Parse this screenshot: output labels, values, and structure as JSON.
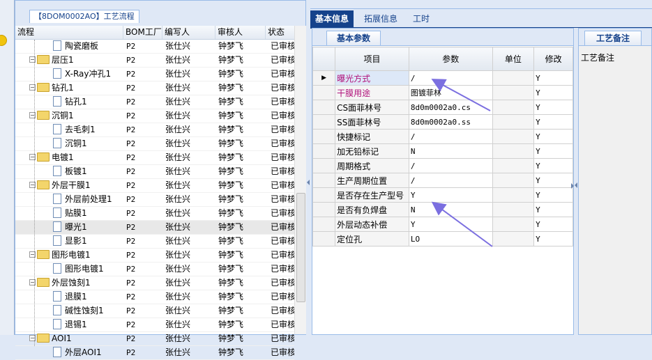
{
  "tree_panel": {
    "title": "【8DOM0002AO】工艺流程",
    "columns": [
      "流程",
      "BOM工厂",
      "编写人",
      "审核人",
      "状态"
    ],
    "rows": [
      {
        "name": "陶瓷磨板",
        "type": "doc",
        "level": 2,
        "bom": "P2",
        "writer": "张仕兴",
        "reviewer": "钟梦飞",
        "status": "已审核"
      },
      {
        "name": "层压1",
        "type": "folder",
        "level": 1,
        "bom": "P2",
        "writer": "张仕兴",
        "reviewer": "钟梦飞",
        "status": "已审核"
      },
      {
        "name": "X-Ray冲孔1",
        "type": "doc",
        "level": 2,
        "bom": "P2",
        "writer": "张仕兴",
        "reviewer": "钟梦飞",
        "status": "已审核"
      },
      {
        "name": "钻孔1",
        "type": "folder",
        "level": 1,
        "bom": "P2",
        "writer": "张仕兴",
        "reviewer": "钟梦飞",
        "status": "已审核"
      },
      {
        "name": "钻孔1",
        "type": "doc",
        "level": 2,
        "bom": "P2",
        "writer": "张仕兴",
        "reviewer": "钟梦飞",
        "status": "已审核"
      },
      {
        "name": "沉铜1",
        "type": "folder",
        "level": 1,
        "bom": "P2",
        "writer": "张仕兴",
        "reviewer": "钟梦飞",
        "status": "已审核"
      },
      {
        "name": "去毛刺1",
        "type": "doc",
        "level": 2,
        "bom": "P2",
        "writer": "张仕兴",
        "reviewer": "钟梦飞",
        "status": "已审核"
      },
      {
        "name": "沉铜1",
        "type": "doc",
        "level": 2,
        "bom": "P2",
        "writer": "张仕兴",
        "reviewer": "钟梦飞",
        "status": "已审核"
      },
      {
        "name": "电镀1",
        "type": "folder",
        "level": 1,
        "bom": "P2",
        "writer": "张仕兴",
        "reviewer": "钟梦飞",
        "status": "已审核"
      },
      {
        "name": "板镀1",
        "type": "doc",
        "level": 2,
        "bom": "P2",
        "writer": "张仕兴",
        "reviewer": "钟梦飞",
        "status": "已审核"
      },
      {
        "name": "外层干膜1",
        "type": "folder",
        "level": 1,
        "bom": "P2",
        "writer": "张仕兴",
        "reviewer": "钟梦飞",
        "status": "已审核"
      },
      {
        "name": "外层前处理1",
        "type": "doc",
        "level": 2,
        "bom": "P2",
        "writer": "张仕兴",
        "reviewer": "钟梦飞",
        "status": "已审核"
      },
      {
        "name": "贴膜1",
        "type": "doc",
        "level": 2,
        "bom": "P2",
        "writer": "张仕兴",
        "reviewer": "钟梦飞",
        "status": "已审核"
      },
      {
        "name": "曝光1",
        "type": "doc",
        "level": 2,
        "bom": "P2",
        "writer": "张仕兴",
        "reviewer": "钟梦飞",
        "status": "已审核",
        "selected": true
      },
      {
        "name": "显影1",
        "type": "doc",
        "level": 2,
        "bom": "P2",
        "writer": "张仕兴",
        "reviewer": "钟梦飞",
        "status": "已审核"
      },
      {
        "name": "图形电镀1",
        "type": "folder",
        "level": 1,
        "bom": "P2",
        "writer": "张仕兴",
        "reviewer": "钟梦飞",
        "status": "已审核"
      },
      {
        "name": "图形电镀1",
        "type": "doc",
        "level": 2,
        "bom": "P2",
        "writer": "张仕兴",
        "reviewer": "钟梦飞",
        "status": "已审核"
      },
      {
        "name": "外层蚀刻1",
        "type": "folder",
        "level": 1,
        "bom": "P2",
        "writer": "张仕兴",
        "reviewer": "钟梦飞",
        "status": "已审核"
      },
      {
        "name": "退膜1",
        "type": "doc",
        "level": 2,
        "bom": "P2",
        "writer": "张仕兴",
        "reviewer": "钟梦飞",
        "status": "已审核"
      },
      {
        "name": "碱性蚀刻1",
        "type": "doc",
        "level": 2,
        "bom": "P2",
        "writer": "张仕兴",
        "reviewer": "钟梦飞",
        "status": "已审核"
      },
      {
        "name": "退锡1",
        "type": "doc",
        "level": 2,
        "bom": "P2",
        "writer": "张仕兴",
        "reviewer": "钟梦飞",
        "status": "已审核"
      },
      {
        "name": "AOI1",
        "type": "folder",
        "level": 1,
        "bom": "P2",
        "writer": "张仕兴",
        "reviewer": "钟梦飞",
        "status": "已审核"
      },
      {
        "name": "外层AOI1",
        "type": "doc",
        "level": 2,
        "bom": "P2",
        "writer": "张仕兴",
        "reviewer": "钟梦飞",
        "status": "已审核"
      }
    ]
  },
  "main_tabs": [
    "基本信息",
    "拓展信息",
    "工时"
  ],
  "active_main_tab": 0,
  "params_panel": {
    "tab_label": "基本参数",
    "columns": [
      "项目",
      "参数",
      "单位",
      "修改"
    ],
    "rows": [
      {
        "item": "曝光方式",
        "value": "/",
        "unit": "",
        "modify": "Y",
        "current": true,
        "magenta": true
      },
      {
        "item": "干膜用途",
        "value": "图镀菲林",
        "unit": "",
        "modify": "Y",
        "magenta": true
      },
      {
        "item": "CS面菲林号",
        "value": "8d0m0002a0.cs",
        "unit": "",
        "modify": "Y"
      },
      {
        "item": "SS面菲林号",
        "value": "8d0m0002a0.ss",
        "unit": "",
        "modify": "Y"
      },
      {
        "item": "快捷标记",
        "value": "/",
        "unit": "",
        "modify": "Y"
      },
      {
        "item": "加无铅标记",
        "value": "N",
        "unit": "",
        "modify": "Y"
      },
      {
        "item": "周期格式",
        "value": "/",
        "unit": "",
        "modify": "Y"
      },
      {
        "item": "生产周期位置",
        "value": "/",
        "unit": "",
        "modify": "Y"
      },
      {
        "item": "是否存在生产型号",
        "value": "Y",
        "unit": "",
        "modify": "Y"
      },
      {
        "item": "是否有负焊盘",
        "value": "N",
        "unit": "",
        "modify": "Y"
      },
      {
        "item": "外层动态补偿",
        "value": "Y",
        "unit": "",
        "modify": "Y"
      },
      {
        "item": "定位孔",
        "value": "LO",
        "unit": "",
        "modify": "Y"
      }
    ]
  },
  "notes_panel": {
    "tab_label": "工艺备注",
    "field_label": "工艺备注"
  },
  "colors": {
    "accent": "#15428b",
    "panel_bg": "#dfe8f6",
    "border": "#99bbe8",
    "magenta_text": "#b0107a",
    "annotation_arrow": "#7b6fe0"
  }
}
